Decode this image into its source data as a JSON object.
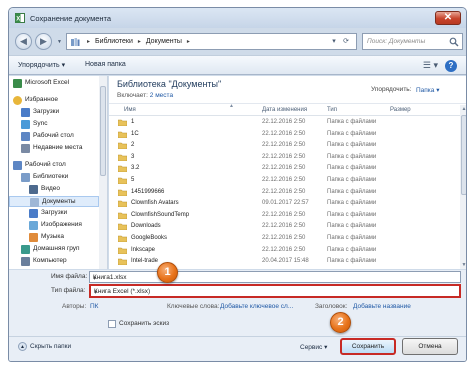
{
  "window": {
    "title": "Сохранение документа",
    "close_glyph": "✕"
  },
  "nav": {
    "back_glyph": "◀",
    "forward_glyph": "▶",
    "recent_glyph": "▼",
    "path": [
      "Библиотеки",
      "Документы"
    ],
    "path_sep": "▸",
    "path_leading_sep": "▸",
    "addr_dropdown_glyph": "▾",
    "refresh_glyph": "⟳",
    "search_placeholder": "Поиск: Документы"
  },
  "toolbar": {
    "organize": "Упорядочить ▾",
    "new_folder": "Новая папка",
    "view_glyph": "☰ ▾",
    "help_glyph": "?"
  },
  "sidebar": {
    "items": [
      {
        "label": "Microsoft Excel",
        "icon": "excel-icon",
        "indent": 0,
        "gap": 0,
        "selected": false
      },
      {
        "label": "Избранное",
        "icon": "star-icon",
        "indent": 0,
        "gap": 1,
        "selected": false
      },
      {
        "label": "Загрузки",
        "icon": "downloads-icon",
        "indent": 1,
        "gap": 0,
        "selected": false
      },
      {
        "label": "Sync",
        "icon": "sync-icon",
        "indent": 1,
        "gap": 0,
        "selected": false
      },
      {
        "label": "Рабочий стол",
        "icon": "desktop-icon",
        "indent": 1,
        "gap": 0,
        "selected": false
      },
      {
        "label": "Недавние места",
        "icon": "recent-places-icon",
        "indent": 1,
        "gap": 0,
        "selected": false
      },
      {
        "label": "Рабочий стол",
        "icon": "desktop-icon",
        "indent": 0,
        "gap": 1,
        "selected": false
      },
      {
        "label": "Библиотеки",
        "icon": "libraries-icon",
        "indent": 1,
        "gap": 0,
        "selected": false
      },
      {
        "label": "Видео",
        "icon": "video-icon",
        "indent": 2,
        "gap": 0,
        "selected": false
      },
      {
        "label": "Документы",
        "icon": "documents-icon",
        "indent": 2,
        "gap": 0,
        "selected": true
      },
      {
        "label": "Загрузки",
        "icon": "downloads-icon",
        "indent": 2,
        "gap": 0,
        "selected": false
      },
      {
        "label": "Изображения",
        "icon": "pictures-icon",
        "indent": 2,
        "gap": 0,
        "selected": false
      },
      {
        "label": "Музыка",
        "icon": "music-icon",
        "indent": 2,
        "gap": 0,
        "selected": false
      },
      {
        "label": "Домашняя груп",
        "icon": "homegroup-icon",
        "indent": 1,
        "gap": 0,
        "selected": false
      },
      {
        "label": "Компьютер",
        "icon": "computer-icon",
        "indent": 1,
        "gap": 0,
        "selected": false
      }
    ]
  },
  "library": {
    "title": "Библиотека \"Документы\"",
    "includes_label": "Включает:",
    "includes_link": "2 места",
    "arrange_label": "Упорядочить:",
    "arrange_value": "Папка ▾"
  },
  "columns": {
    "name": "Имя",
    "date": "Дата изменения",
    "type": "Тип",
    "size": "Размер"
  },
  "files": [
    {
      "name": "1",
      "date": "22.12.2016 2:50",
      "type": "Папка с файлами"
    },
    {
      "name": "1C",
      "date": "22.12.2016 2:50",
      "type": "Папка с файлами"
    },
    {
      "name": "2",
      "date": "22.12.2016 2:50",
      "type": "Папка с файлами"
    },
    {
      "name": "3",
      "date": "22.12.2016 2:50",
      "type": "Папка с файлами"
    },
    {
      "name": "3.2",
      "date": "22.12.2016 2:50",
      "type": "Папка с файлами"
    },
    {
      "name": "5",
      "date": "22.12.2016 2:50",
      "type": "Папка с файлами"
    },
    {
      "name": "1451999666",
      "date": "22.12.2016 2:50",
      "type": "Папка с файлами"
    },
    {
      "name": "Clownfish Avatars",
      "date": "09.01.2017 22:57",
      "type": "Папка с файлами"
    },
    {
      "name": "ClownfishSoundTemp",
      "date": "22.12.2016 2:50",
      "type": "Папка с файлами"
    },
    {
      "name": "Downloads",
      "date": "22.12.2016 2:50",
      "type": "Папка с файлами"
    },
    {
      "name": "GoogleBooks",
      "date": "22.12.2016 2:50",
      "type": "Папка с файлами"
    },
    {
      "name": "Inkscape",
      "date": "22.12.2016 2:50",
      "type": "Папка с файлами"
    },
    {
      "name": "Intel-trade",
      "date": "20.04.2017 15:48",
      "type": "Папка с файлами"
    }
  ],
  "form": {
    "filename_label": "Имя файла:",
    "filename_value": "Книга1.xlsx",
    "filetype_label": "Тип файла:",
    "filetype_value": "Книга Excel (*.xlsx)",
    "authors_label": "Авторы:",
    "authors_value": "ПК",
    "keywords_label": "Ключевые слова:",
    "keywords_value": "Добавьте ключевое сл...",
    "title_label": "Заголовок:",
    "title_value": "Добавьте название",
    "thumbnail_label": "Сохранить эскиз",
    "dropdown_glyph": "▾"
  },
  "footer": {
    "hide_folders": "Скрыть папки",
    "hide_glyph": "▲",
    "service": "Сервис ▾",
    "save": "Сохранить",
    "cancel": "Отмена"
  },
  "callouts": [
    "1",
    "2"
  ],
  "colors": {
    "highlight_red": "#c72a25",
    "callout_orange": "#e8731a",
    "link_blue": "#2059a5",
    "folder_yellow": "#e8c25a"
  }
}
